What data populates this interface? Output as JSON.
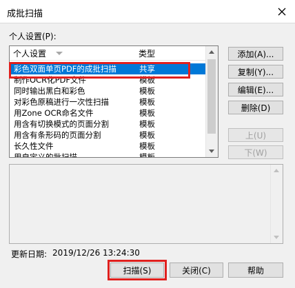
{
  "window": {
    "title": "成批扫描"
  },
  "settings": {
    "label": "个人设置(P):",
    "columns": {
      "name": "个人设置",
      "type": "类型"
    },
    "rows": [
      {
        "name": "彩色双面单页PDF的成批扫描",
        "type": "共享",
        "selected": true
      },
      {
        "name": "制作OCR化PDF文件",
        "type": "模板"
      },
      {
        "name": "同时输出黑白和彩色",
        "type": "模板"
      },
      {
        "name": "对彩色原稿进行一次性扫描",
        "type": "模板"
      },
      {
        "name": "用Zone OCR命名文件",
        "type": "模板"
      },
      {
        "name": "用含有切换模式的页面分割",
        "type": "模板"
      },
      {
        "name": "用含有条形码的页面分割",
        "type": "模板"
      },
      {
        "name": "长久性文件",
        "type": "模板"
      },
      {
        "name": "用自定义的批扫描",
        "type": "模板"
      }
    ]
  },
  "buttons": {
    "add": "添加(A)...",
    "copy": "复制(Y)...",
    "edit": "编辑(E)...",
    "delete": "删除(D)",
    "up": "上(U)",
    "down": "下(W)",
    "scan": "扫描(S)",
    "close": "关闭(C)",
    "help": "帮助"
  },
  "updated": {
    "label": "更新日期:",
    "value": "2019/12/26 13:24:30"
  },
  "colors": {
    "selection": "#0078d7",
    "annotation": "#e0201e"
  }
}
